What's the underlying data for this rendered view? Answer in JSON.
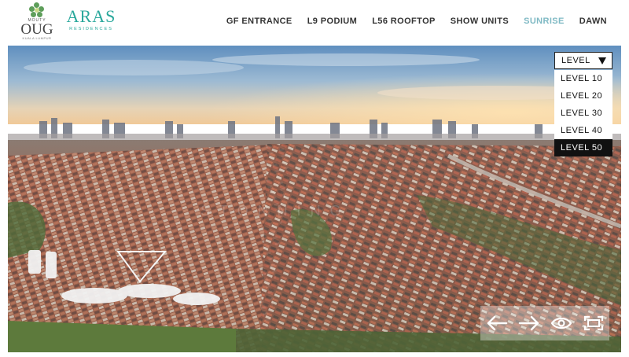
{
  "brand": {
    "oug_top": "MOUTY",
    "oug_name": "OUG",
    "oug_tag": "KUALA LUMPUR",
    "aras_name": "ARAS",
    "aras_sub": "RESIDENCES"
  },
  "nav": {
    "items": [
      {
        "label": "GF ENTRANCE",
        "active": false
      },
      {
        "label": "L9 PODIUM",
        "active": false
      },
      {
        "label": "L56 ROOFTOP",
        "active": false
      },
      {
        "label": "SHOW UNITS",
        "active": false
      },
      {
        "label": "SUNRISE",
        "active": true
      },
      {
        "label": "DAWN",
        "active": false
      }
    ],
    "active_color": "#7fb9c4"
  },
  "level_select": {
    "label": "LEVEL",
    "options": [
      "LEVEL 10",
      "LEVEL 20",
      "LEVEL 30",
      "LEVEL 40",
      "LEVEL 50"
    ],
    "selected": "LEVEL 50"
  },
  "controls": {
    "icons": [
      "arrow-left-icon",
      "arrow-right-icon",
      "eye-icon",
      "fullscreen-icon"
    ]
  }
}
